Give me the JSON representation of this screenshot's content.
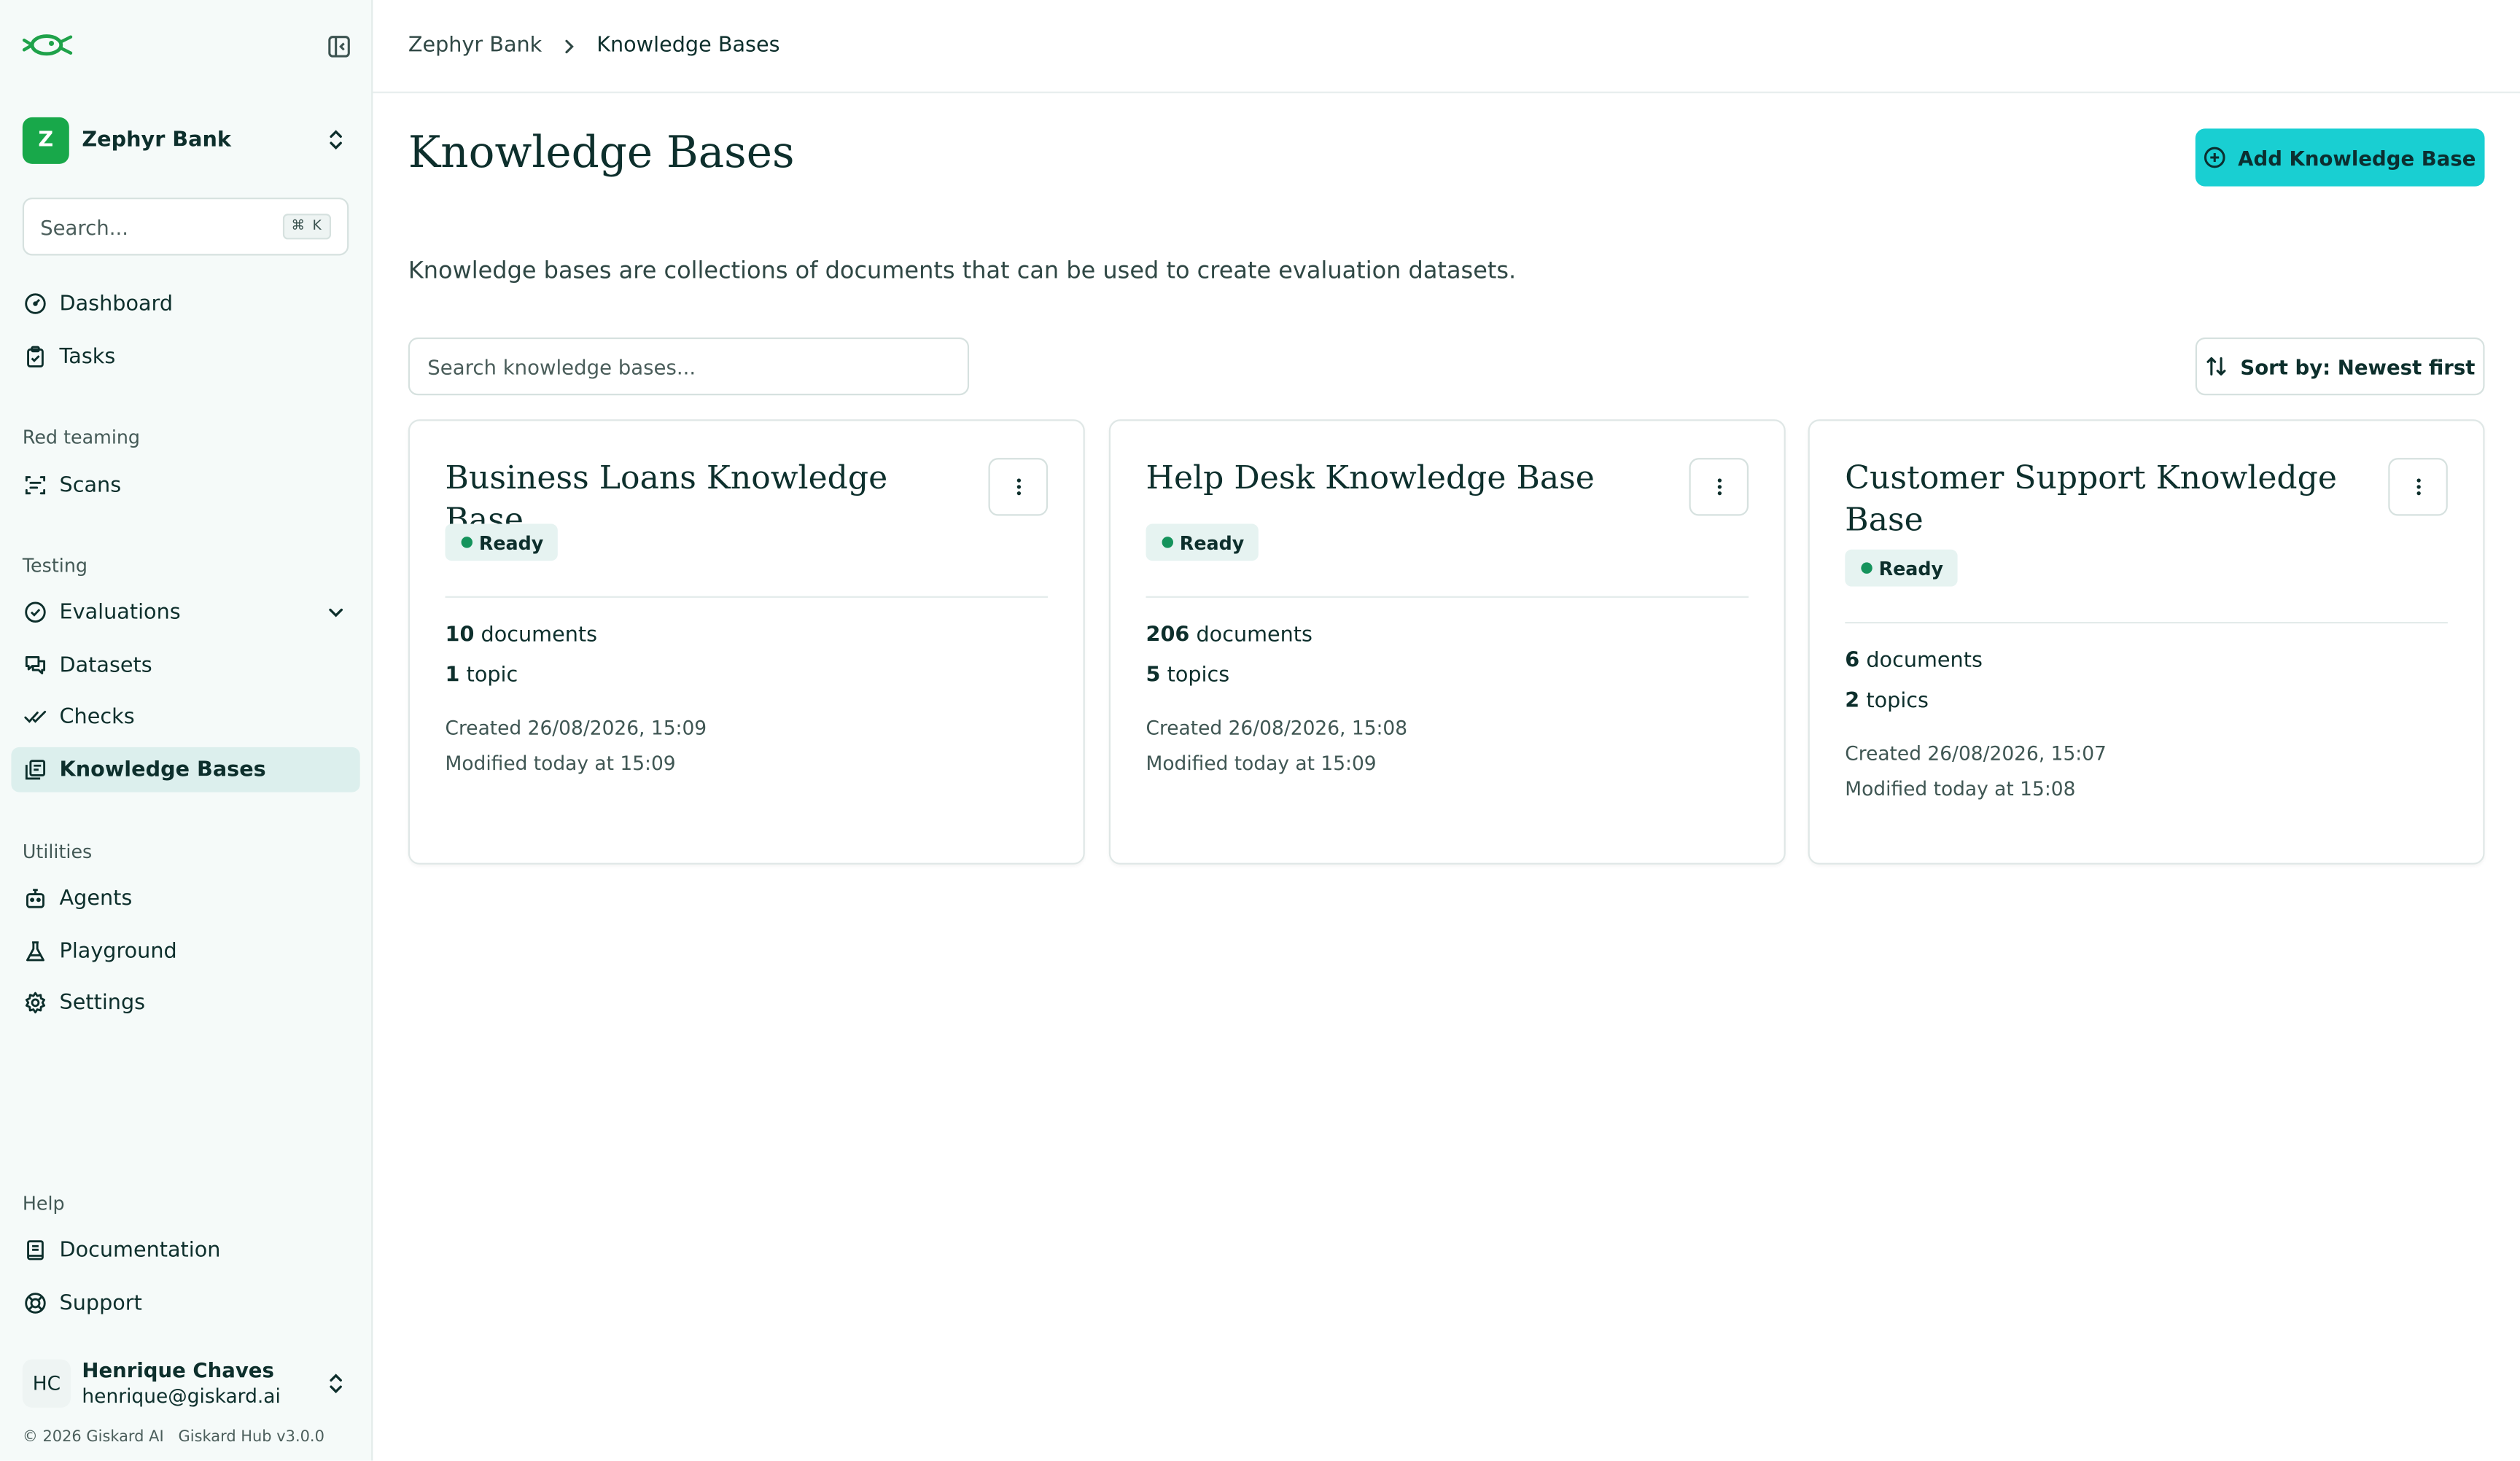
{
  "sidebar": {
    "org": {
      "initial": "Z",
      "name": "Zephyr Bank"
    },
    "search": {
      "placeholder": "Search...",
      "shortcut": "⌘ K"
    },
    "items": [
      {
        "label": "Dashboard",
        "icon": "dashboard-icon"
      },
      {
        "label": "Tasks",
        "icon": "clipboard-icon"
      }
    ],
    "sections": {
      "red_teaming": {
        "label": "Red teaming",
        "items": [
          {
            "label": "Scans",
            "icon": "scan-icon"
          }
        ]
      },
      "testing": {
        "label": "Testing",
        "items": [
          {
            "label": "Evaluations",
            "icon": "check-circle-icon"
          },
          {
            "label": "Datasets",
            "icon": "chat-icon"
          },
          {
            "label": "Checks",
            "icon": "double-check-icon"
          },
          {
            "label": "Knowledge Bases",
            "icon": "library-icon",
            "active": true
          }
        ]
      },
      "utilities": {
        "label": "Utilities",
        "items": [
          {
            "label": "Agents",
            "icon": "bot-icon"
          },
          {
            "label": "Playground",
            "icon": "flask-icon"
          },
          {
            "label": "Settings",
            "icon": "gear-icon"
          }
        ]
      },
      "help": {
        "label": "Help",
        "items": [
          {
            "label": "Documentation",
            "icon": "book-icon"
          },
          {
            "label": "Support",
            "icon": "lifebuoy-icon"
          }
        ]
      }
    },
    "user": {
      "initials": "HC",
      "name": "Henrique Chaves",
      "email": "henrique@giskard.ai"
    },
    "footer": {
      "copyright": "© 2026 Giskard AI",
      "version": "Giskard Hub v3.0.0"
    }
  },
  "breadcrumb": {
    "root": "Zephyr Bank",
    "current": "Knowledge Bases"
  },
  "page": {
    "title": "Knowledge Bases",
    "add_button": "Add Knowledge Base",
    "description": "Knowledge bases are collections of documents that can be used to create evaluation datasets.",
    "search_placeholder": "Search knowledge bases...",
    "sort_label": "Sort by: Newest first"
  },
  "knowledge_bases": [
    {
      "title": "Business Loans Knowledge Base",
      "status": "Ready",
      "documents_count": "10",
      "documents_label": "documents",
      "topics_count": "1",
      "topics_label": "topic",
      "created": "Created 26/08/2026, 15:09",
      "modified": "Modified today at 15:09"
    },
    {
      "title": "Help Desk Knowledge Base",
      "status": "Ready",
      "documents_count": "206",
      "documents_label": "documents",
      "topics_count": "5",
      "topics_label": "topics",
      "created": "Created 26/08/2026, 15:08",
      "modified": "Modified today at 15:09"
    },
    {
      "title": "Customer Support Knowledge Base",
      "status": "Ready",
      "documents_count": "6",
      "documents_label": "documents",
      "topics_count": "2",
      "topics_label": "topics",
      "created": "Created 26/08/2026, 15:07",
      "modified": "Modified today at 15:08"
    }
  ],
  "colors": {
    "accent": "#19cfd2",
    "org_avatar": "#18a84a",
    "status_ready": "#15935c",
    "sidebar_active": "#dcefed",
    "logo": "#1fa24a"
  }
}
